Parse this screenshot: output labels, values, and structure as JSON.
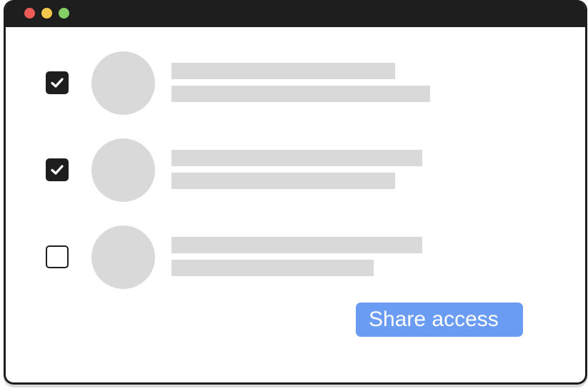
{
  "window": {
    "controls": [
      {
        "name": "close",
        "color": "#ec5b56"
      },
      {
        "name": "minimize",
        "color": "#f3c94b"
      },
      {
        "name": "maximize",
        "color": "#83d067"
      }
    ]
  },
  "users": [
    {
      "checked": true
    },
    {
      "checked": true
    },
    {
      "checked": false
    }
  ],
  "actions": {
    "share_label": "Share access",
    "share_color": "#6b9cf4"
  },
  "colors": {
    "titlebar": "#1e1e1e",
    "placeholder": "#d9d9d9"
  },
  "icons": {
    "check": "checkmark-icon"
  }
}
